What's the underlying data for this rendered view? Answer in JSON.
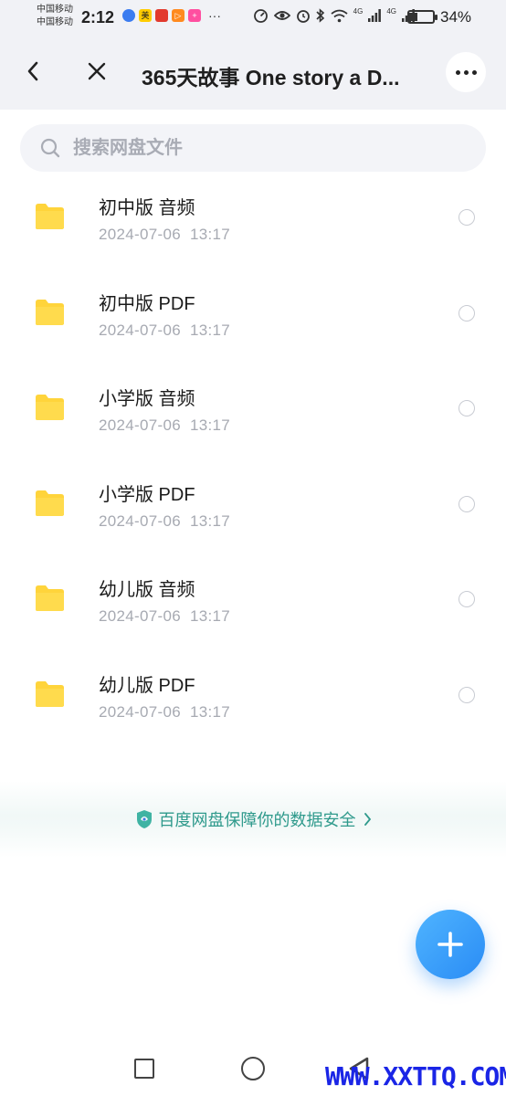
{
  "status_bar": {
    "carrier_line1": "中国移动",
    "carrier_line2": "中国移动",
    "time": "2:12",
    "network_1": "4G",
    "network_2": "4G",
    "battery_level": 0.34,
    "battery_text": "34%",
    "icons": [
      "shield-notification-icon",
      "meituan-notification-icon",
      "app-notification-icon",
      "play-notification-icon",
      "plus-notification-icon",
      "more-notifications-icon",
      "speed-icon",
      "eye-icon",
      "alarm-icon",
      "bluetooth-icon",
      "wifi-icon",
      "signal-icon",
      "signal-icon",
      "battery-icon"
    ]
  },
  "header": {
    "title": "365天故事 One story a D...",
    "back_icon": "chevron-left-icon",
    "close_icon": "close-icon",
    "more_icon": "more-horizontal-icon"
  },
  "search": {
    "placeholder": "搜索网盘文件",
    "value": ""
  },
  "files": [
    {
      "name": "初中版 音频",
      "date": "2024-07-06  13:17"
    },
    {
      "name": "初中版 PDF",
      "date": "2024-07-06  13:17"
    },
    {
      "name": "小学版 音频",
      "date": "2024-07-06  13:17"
    },
    {
      "name": "小学版 PDF",
      "date": "2024-07-06  13:17"
    },
    {
      "name": "幼儿版 音频",
      "date": "2024-07-06  13:17"
    },
    {
      "name": "幼儿版 PDF",
      "date": "2024-07-06  13:17"
    }
  ],
  "security_banner": {
    "text": "百度网盘保障你的数据安全"
  },
  "fab": {
    "icon": "plus-icon"
  },
  "watermark": "WWW.XXTTQ.COM",
  "colors": {
    "header_bg": "#f1f2f6",
    "folder": "#ffd43b",
    "accent_green": "#2f9a8c",
    "fab_blue": "#2a8cf5"
  }
}
